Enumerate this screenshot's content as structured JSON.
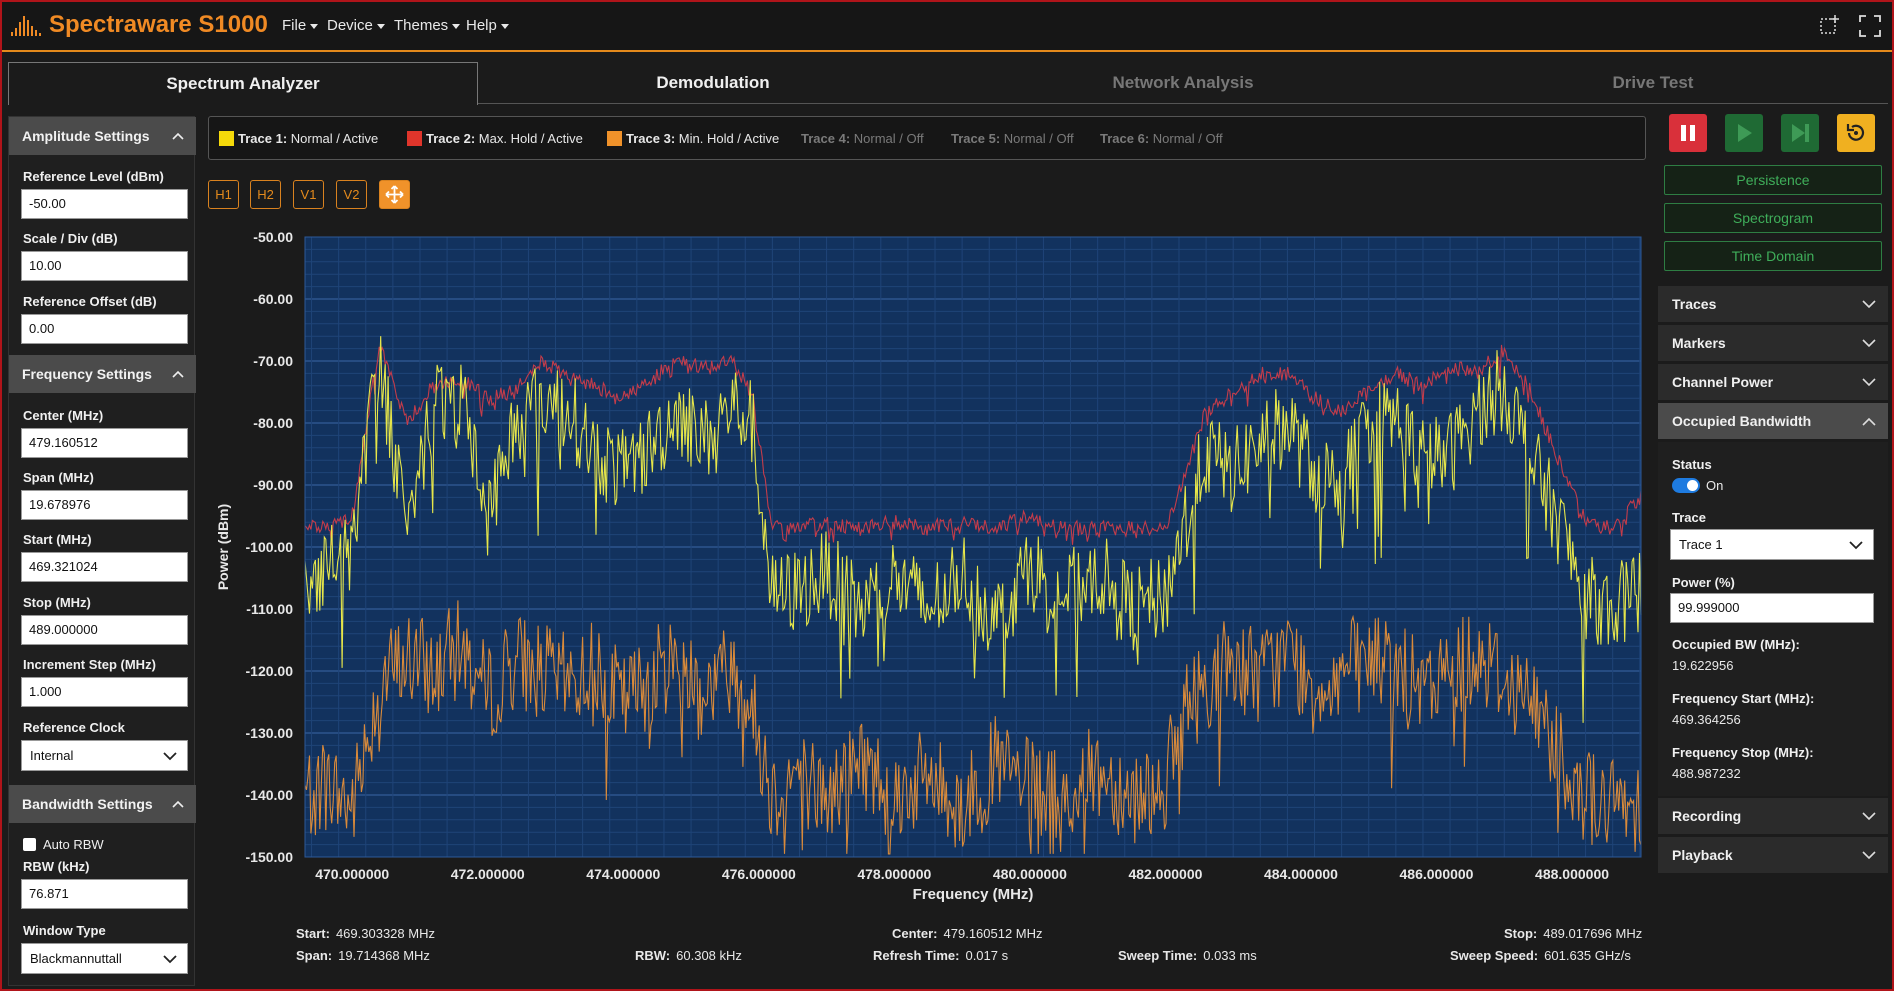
{
  "app": {
    "title": "Spectraware S1000"
  },
  "menu": [
    {
      "label": "File"
    },
    {
      "label": "Device"
    },
    {
      "label": "Themes"
    },
    {
      "label": "Help"
    }
  ],
  "tabs": [
    {
      "label": "Spectrum Analyzer"
    },
    {
      "label": "Demodulation"
    },
    {
      "label": "Network Analysis"
    },
    {
      "label": "Drive Test"
    }
  ],
  "amplitude": {
    "header": "Amplitude Settings",
    "ref_level_label": "Reference Level (dBm)",
    "ref_level": "-50.00",
    "scale_label": "Scale / Div (dB)",
    "scale": "10.00",
    "offset_label": "Reference Offset (dB)",
    "offset": "0.00"
  },
  "frequency": {
    "header": "Frequency Settings",
    "center_label": "Center (MHz)",
    "center": "479.160512",
    "span_label": "Span (MHz)",
    "span": "19.678976",
    "start_label": "Start (MHz)",
    "start": "469.321024",
    "stop_label": "Stop (MHz)",
    "stop": "489.000000",
    "step_label": "Increment Step (MHz)",
    "step": "1.000",
    "clock_label": "Reference Clock",
    "clock": "Internal"
  },
  "bandwidth": {
    "header": "Bandwidth Settings",
    "auto_rbw_label": "Auto RBW",
    "auto_rbw": false,
    "rbw_label": "RBW (kHz)",
    "rbw": "76.871",
    "window_label": "Window Type",
    "window": "Blackmannuttall"
  },
  "traces": [
    {
      "name": "Trace 1:",
      "state": "Normal / Active",
      "color": "#f5d90a",
      "active": true
    },
    {
      "name": "Trace 2:",
      "state": "Max. Hold / Active",
      "color": "#e0352b",
      "active": true
    },
    {
      "name": "Trace 3:",
      "state": "Min. Hold / Active",
      "color": "#f0922a",
      "active": true
    },
    {
      "name": "Trace 4:",
      "state": "Normal / Off",
      "active": false
    },
    {
      "name": "Trace 5:",
      "state": "Normal / Off",
      "active": false
    },
    {
      "name": "Trace 6:",
      "state": "Normal / Off",
      "active": false
    }
  ],
  "marker_tools": [
    {
      "label": "H1"
    },
    {
      "label": "H2"
    },
    {
      "label": "V1"
    },
    {
      "label": "V2"
    },
    {
      "icon": "move-icon"
    }
  ],
  "controls": [
    {
      "icon": "pause-icon",
      "color": "#d9303a"
    },
    {
      "icon": "play-icon",
      "color": "#1f6a34"
    },
    {
      "icon": "step-forward-icon",
      "color": "#1f6a34"
    },
    {
      "icon": "reset-icon",
      "color": "#f0b020"
    }
  ],
  "views": {
    "persistence": "Persistence",
    "spectrogram": "Spectrogram",
    "time_domain": "Time Domain"
  },
  "chart_data": {
    "type": "line",
    "xlabel": "Frequency (MHz)",
    "ylabel": "Power (dBm)",
    "xlim": [
      469.303328,
      489.017696
    ],
    "ylim": [
      -150,
      -50
    ],
    "xticks": [
      "470.000000",
      "472.000000",
      "474.000000",
      "476.000000",
      "478.000000",
      "480.000000",
      "482.000000",
      "484.000000",
      "486.000000",
      "488.000000"
    ],
    "yticks": [
      "-50.00",
      "-60.00",
      "-70.00",
      "-80.00",
      "-90.00",
      "-100.00",
      "-110.00",
      "-120.00",
      "-130.00",
      "-140.00",
      "-150.00"
    ],
    "grid": true,
    "series": [
      {
        "name": "Trace 1",
        "color": "#e6e64a",
        "x": [
          469.3,
          469.6,
          470.0,
          470.4,
          470.8,
          471.2,
          471.6,
          472.0,
          472.4,
          472.8,
          473.2,
          473.6,
          474.0,
          474.4,
          474.8,
          475.2,
          475.6,
          475.9,
          476.2,
          476.6,
          477.0,
          477.5,
          478.0,
          478.5,
          479.0,
          479.5,
          480.0,
          480.5,
          481.0,
          481.5,
          482.0,
          482.3,
          482.6,
          483.0,
          483.4,
          483.8,
          484.2,
          484.6,
          485.0,
          485.4,
          485.8,
          486.2,
          486.6,
          487.0,
          487.4,
          487.8,
          488.2,
          488.6,
          489.0
        ],
        "y": [
          -106,
          -103,
          -100,
          -70,
          -95,
          -78,
          -75,
          -95,
          -80,
          -76,
          -78,
          -85,
          -88,
          -84,
          -78,
          -83,
          -77,
          -80,
          -108,
          -107,
          -104,
          -110,
          -105,
          -110,
          -104,
          -112,
          -103,
          -108,
          -104,
          -110,
          -108,
          -95,
          -85,
          -88,
          -83,
          -80,
          -88,
          -90,
          -80,
          -79,
          -86,
          -85,
          -78,
          -74,
          -86,
          -96,
          -108,
          -110,
          -107
        ]
      },
      {
        "name": "Trace 2",
        "color": "#c43c4a",
        "x": [
          469.3,
          469.6,
          470.0,
          470.4,
          470.8,
          471.2,
          471.6,
          472.0,
          472.4,
          472.8,
          473.2,
          473.6,
          474.0,
          474.4,
          474.8,
          475.2,
          475.6,
          475.9,
          476.2,
          476.6,
          477.0,
          477.5,
          478.0,
          478.5,
          479.0,
          479.5,
          480.0,
          480.5,
          481.0,
          481.5,
          482.0,
          482.3,
          482.6,
          483.0,
          483.4,
          483.8,
          484.2,
          484.6,
          485.0,
          485.4,
          485.8,
          486.2,
          486.6,
          487.0,
          487.4,
          487.8,
          488.2,
          488.6,
          489.0
        ],
        "y": [
          -96,
          -97,
          -95,
          -67,
          -80,
          -74,
          -73,
          -76,
          -75,
          -70,
          -73,
          -74,
          -76,
          -73,
          -70,
          -71,
          -70,
          -75,
          -97,
          -97,
          -96,
          -97,
          -96,
          -97,
          -96,
          -97,
          -95,
          -97,
          -97,
          -97,
          -97,
          -88,
          -78,
          -75,
          -72,
          -72,
          -76,
          -78,
          -75,
          -72,
          -74,
          -71,
          -72,
          -68,
          -75,
          -86,
          -96,
          -97,
          -92
        ]
      },
      {
        "name": "Trace 3",
        "color": "#d98a3a",
        "x": [
          469.3,
          469.6,
          470.0,
          470.4,
          470.8,
          471.2,
          471.6,
          472.0,
          472.4,
          472.8,
          473.2,
          473.6,
          474.0,
          474.4,
          474.8,
          475.2,
          475.6,
          475.9,
          476.2,
          476.6,
          477.0,
          477.5,
          478.0,
          478.5,
          479.0,
          479.5,
          480.0,
          480.5,
          481.0,
          481.5,
          482.0,
          482.3,
          482.6,
          483.0,
          483.4,
          483.8,
          484.2,
          484.6,
          485.0,
          485.4,
          485.8,
          486.2,
          486.6,
          487.0,
          487.4,
          487.8,
          488.2,
          488.6,
          489.0
        ],
        "y": [
          -140,
          -138,
          -142,
          -122,
          -118,
          -120,
          -116,
          -124,
          -118,
          -120,
          -122,
          -119,
          -125,
          -121,
          -118,
          -123,
          -119,
          -126,
          -140,
          -136,
          -141,
          -134,
          -140,
          -137,
          -142,
          -135,
          -139,
          -141,
          -136,
          -140,
          -138,
          -126,
          -122,
          -118,
          -121,
          -117,
          -123,
          -120,
          -118,
          -119,
          -124,
          -120,
          -117,
          -121,
          -125,
          -132,
          -140,
          -142,
          -141
        ]
      }
    ]
  },
  "info": {
    "start_label": "Start:",
    "start": "469.303328 MHz",
    "span_label": "Span:",
    "span": "19.714368 MHz",
    "rbw_label": "RBW:",
    "rbw": "60.308 kHz",
    "center_label": "Center:",
    "center": "479.160512 MHz",
    "refresh_label": "Refresh Time:",
    "refresh": "0.017 s",
    "sweep_time_label": "Sweep Time:",
    "sweep_time": "0.033 ms",
    "stop_label": "Stop:",
    "stop": "489.017696 MHz",
    "sweep_speed_label": "Sweep Speed:",
    "sweep_speed": "601.635 GHz/s"
  },
  "right": {
    "traces": "Traces",
    "markers": "Markers",
    "channel_power": "Channel Power",
    "obw": "Occupied Bandwidth",
    "status_label": "Status",
    "status": "On",
    "trace_label": "Trace",
    "trace": "Trace 1",
    "power_label": "Power (%)",
    "power": "99.999000",
    "obw_label": "Occupied BW (MHz):",
    "obw_value": "19.622956",
    "fstart_label": "Frequency Start (MHz):",
    "fstart": "469.364256",
    "fstop_label": "Frequency Stop (MHz):",
    "fstop": "488.987232",
    "recording": "Recording",
    "playback": "Playback"
  }
}
